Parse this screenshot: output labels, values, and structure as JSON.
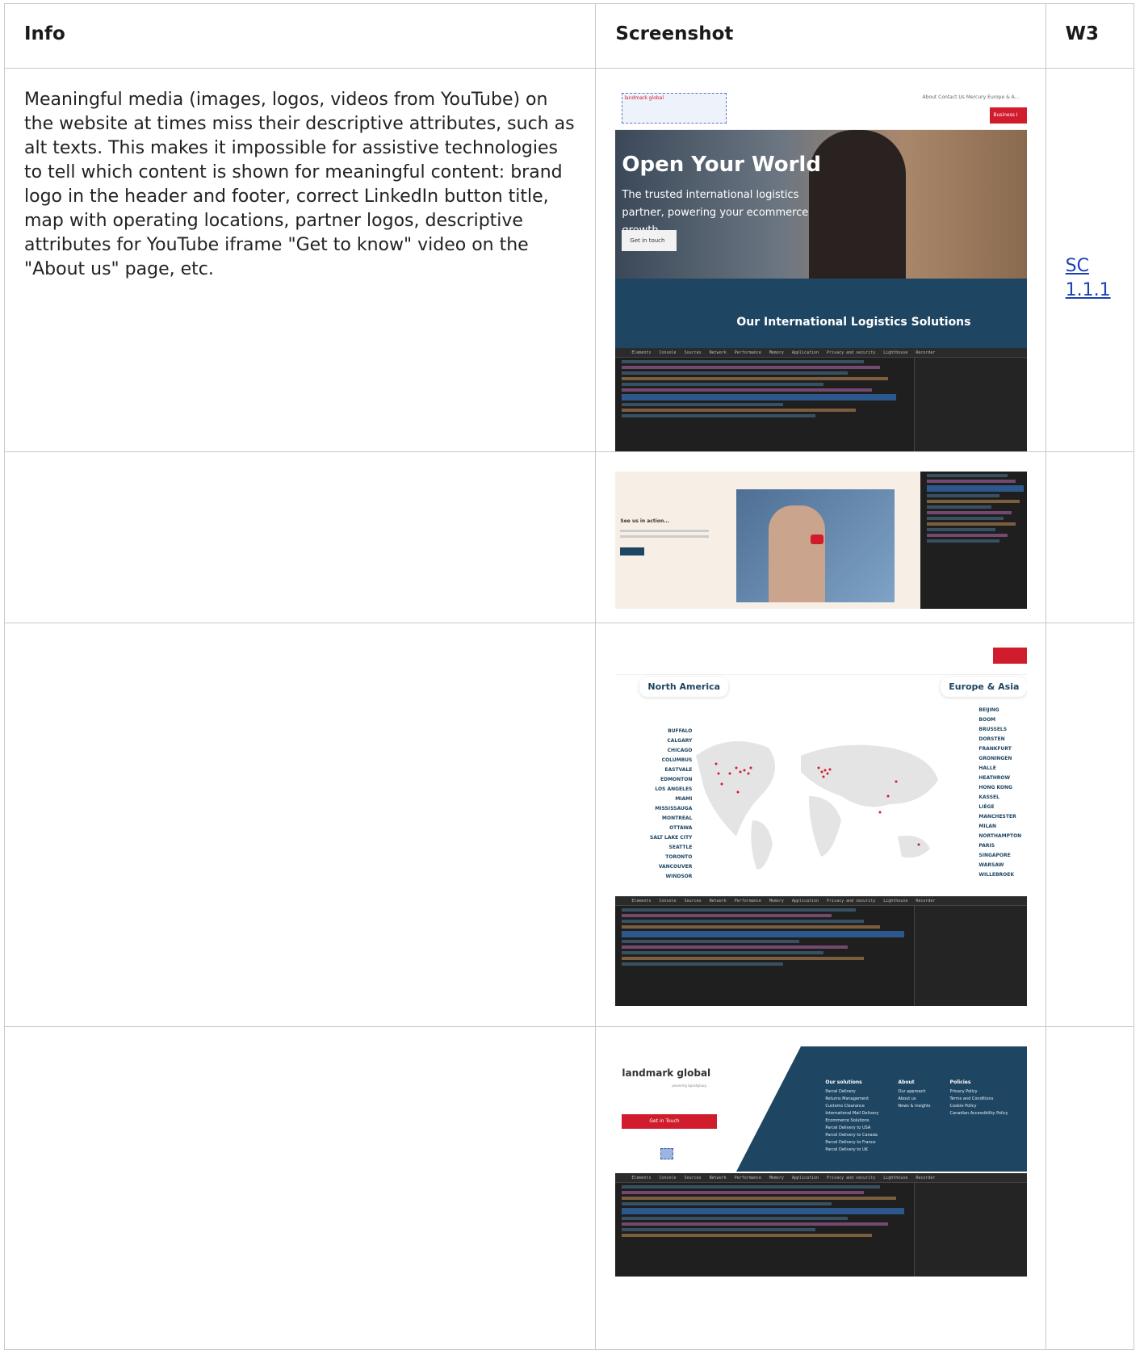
{
  "table": {
    "headers": {
      "info": "Info",
      "screenshot": "Screenshot",
      "w3": "W3"
    },
    "rows": [
      {
        "info": "Meaningful media (images, logos, videos from YouTube) on the website at times miss their descriptive attributes, such as alt texts. This makes it impossible for assistive technologies to tell which content is shown for meaningful content: brand logo in the header and footer, correct LinkedIn button title, map with operating locations, partner logos, descriptive attributes for YouTube iframe \"Get to know\" video on the \"About us\" page, etc.",
        "w3": "SC 1.1.1"
      },
      {
        "info": "",
        "w3": ""
      },
      {
        "info": "",
        "w3": ""
      },
      {
        "info": "",
        "w3": ""
      }
    ]
  },
  "screenshots": {
    "hero": {
      "title": "Open Your World",
      "subtitle": "The trusted international logistics partner, powering your ecommerce growth",
      "cta": "Get in touch",
      "band": "Our International Logistics Solutions",
      "nav": "About  Contact Us  Mercury  Europe & A...",
      "business": "Business I",
      "logo_alt": "landmark global"
    },
    "video": {
      "heading": "See us in action..."
    },
    "map": {
      "region_left": "North America",
      "region_right": "Europe & Asia",
      "cities_left": [
        "BUFFALO",
        "CALGARY",
        "CHICAGO",
        "COLUMBUS",
        "EASTVALE",
        "EDMONTON",
        "LOS ANGELES",
        "MIAMI",
        "MISSISSAUGA",
        "MONTREAL",
        "OTTAWA",
        "SALT LAKE CITY",
        "SEATTLE",
        "TORONTO",
        "VANCOUVER",
        "WINDSOR"
      ],
      "cities_right": [
        "BEIJING",
        "BOOM",
        "BRUSSELS",
        "DORSTEN",
        "FRANKFURT",
        "GRONINGEN",
        "HALLE",
        "HEATHROW",
        "HONG KONG",
        "KASSEL",
        "LIÈGE",
        "MANCHESTER",
        "MILAN",
        "NORTHAMPTON",
        "PARIS",
        "SINGAPORE",
        "WARSAW",
        "WILLEBROEK"
      ]
    },
    "footer": {
      "logo": "landmark global",
      "logo_sub": "powering bpostgroup",
      "cta": "Get in Touch",
      "col1_title": "Our solutions",
      "col1_items": [
        "Parcel Delivery",
        "Returns Management",
        "Customs Clearance",
        "International Mail Delivery",
        "Ecommerce Solutions",
        "Parcel Delivery to USA",
        "Parcel Delivery to Canada",
        "Parcel Delivery to France",
        "Parcel Delivery to UK"
      ],
      "col2_title": "About",
      "col2_items": [
        "Our approach",
        "About us",
        "News & Insights"
      ],
      "col3_title": "Policies",
      "col3_items": [
        "Privacy Policy",
        "Terms and Conditions",
        "Cookie Policy",
        "Canadian Accessibility Policy"
      ]
    },
    "devtools_tabs": [
      "Elements",
      "Console",
      "Sources",
      "Network",
      "Performance",
      "Memory",
      "Application",
      "Privacy and security",
      "Lighthouse",
      "Recorder"
    ]
  },
  "colors": {
    "brand_red": "#d01c2c",
    "brand_navy": "#1e4663",
    "link": "#1c3fb6"
  }
}
